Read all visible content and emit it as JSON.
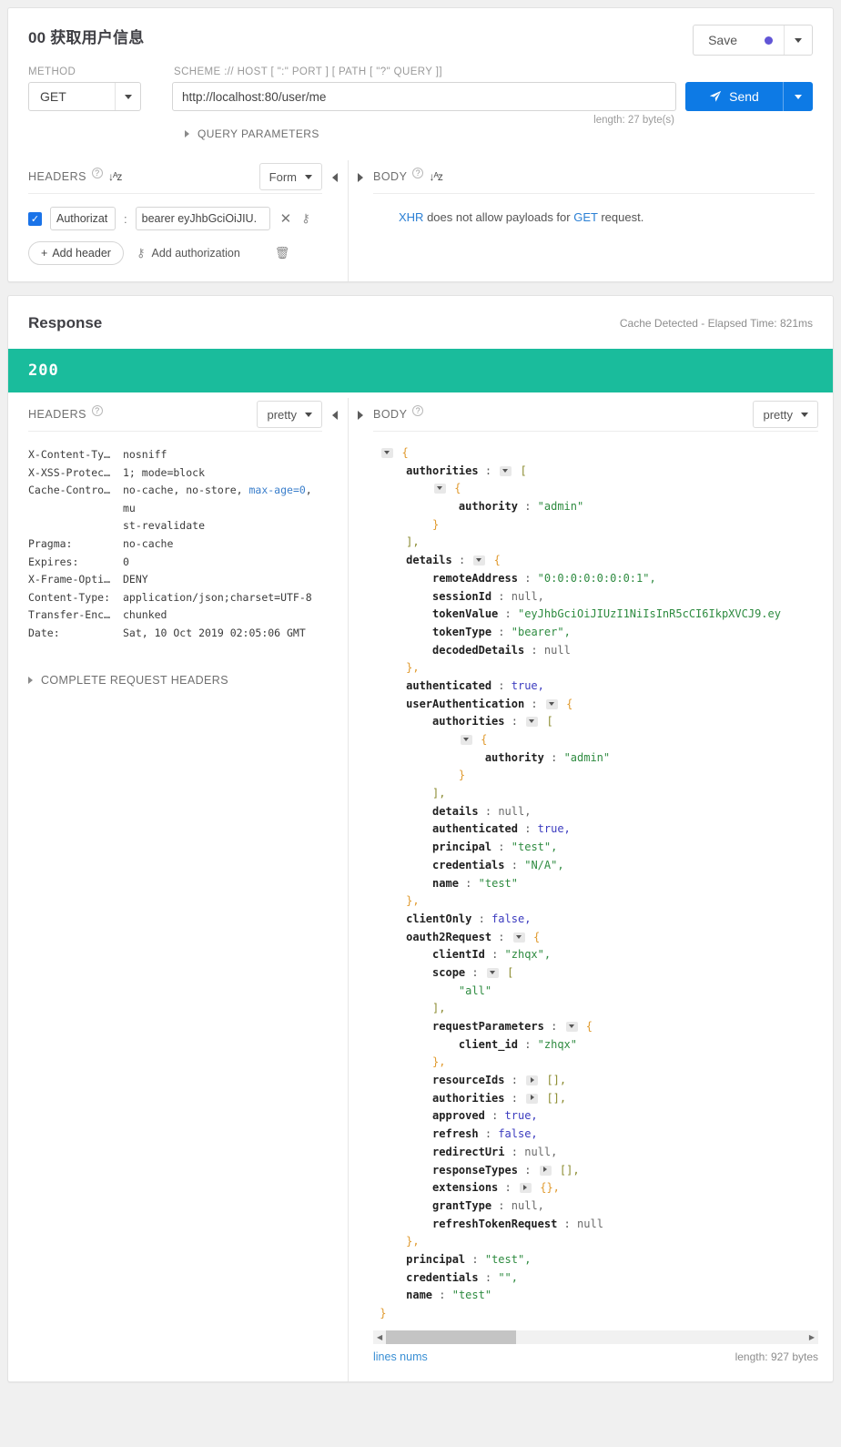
{
  "request": {
    "title": "00 获取用户信息",
    "save": {
      "label": "Save",
      "dot_color": "#6155d6"
    },
    "method_label": "METHOD",
    "method_value": "GET",
    "url_label": "SCHEME :// HOST [ \":\" PORT ] [ PATH [ \"?\" QUERY ]]",
    "url_value": "http://localhost:80/user/me",
    "send_label": "Send",
    "length_note": "length: 27 byte(s)",
    "query_parameters_label": "QUERY PARAMETERS",
    "headers_panel": {
      "title": "HEADERS",
      "format_select": "Form",
      "rows": [
        {
          "checked": true,
          "key": "Authorizat",
          "value": "bearer eyJhbGciOiJIU.",
          "separator": ":"
        }
      ],
      "add_header_label": "Add header",
      "add_authorization_label": "Add authorization"
    },
    "body_panel": {
      "title": "BODY",
      "note_prefix": "XHR",
      "note_middle": " does not allow payloads for ",
      "note_method": "GET",
      "note_suffix": " request."
    }
  },
  "response": {
    "title": "Response",
    "meta": "Cache Detected - Elapsed Time: 821ms",
    "status_code": "200",
    "status_color": "#1abc9c",
    "headers_panel": {
      "title": "HEADERS",
      "format_select": "pretty",
      "rows": [
        {
          "name": "X-Content-Ty…",
          "value": "nosniff"
        },
        {
          "name": "X-XSS-Protec…",
          "value": "1; mode=block"
        },
        {
          "name": "Cache-Contro…",
          "value": "no-cache, no-store, max-age=0, mu\nst-revalidate"
        },
        {
          "name": "Pragma:",
          "value": "no-cache"
        },
        {
          "name": "Expires:",
          "value": "0"
        },
        {
          "name": "X-Frame-Opti…",
          "value": "DENY"
        },
        {
          "name": "Content-Type:",
          "value": "application/json;charset=UTF-8"
        },
        {
          "name": "Transfer-Enc…",
          "value": "chunked"
        },
        {
          "name": "Date:",
          "value": "Sat, 10 Oct 2019 02:05:06 GMT"
        }
      ],
      "complete_request_headers_label": "COMPLETE REQUEST HEADERS"
    },
    "body_panel": {
      "title": "BODY",
      "format_select": "pretty",
      "lines_nums_label": "lines nums",
      "length_label": "length: 927 bytes",
      "json_lines": [
        {
          "indent": 0,
          "toggle": "open",
          "text": "{",
          "cls": "br"
        },
        {
          "indent": 1,
          "key": "authorities",
          "toggle": "open",
          "text": "[",
          "cls": "brk"
        },
        {
          "indent": 2,
          "toggle": "open",
          "text": "{",
          "cls": "br"
        },
        {
          "indent": 3,
          "key": "authority",
          "value": "\"admin\"",
          "vcls": "s"
        },
        {
          "indent": 2,
          "text": "}",
          "cls": "br"
        },
        {
          "indent": 1,
          "text": "],",
          "cls": "brk"
        },
        {
          "indent": 1,
          "key": "details",
          "toggle": "open",
          "text": "{",
          "cls": "br"
        },
        {
          "indent": 2,
          "key": "remoteAddress",
          "value": "\"0:0:0:0:0:0:0:1\",",
          "vcls": "s"
        },
        {
          "indent": 2,
          "key": "sessionId",
          "value": "null,",
          "vcls": "n"
        },
        {
          "indent": 2,
          "key": "tokenValue",
          "value": "\"eyJhbGciOiJIUzI1NiIsInR5cCI6IkpXVCJ9.ey",
          "vcls": "s"
        },
        {
          "indent": 2,
          "key": "tokenType",
          "value": "\"bearer\",",
          "vcls": "s"
        },
        {
          "indent": 2,
          "key": "decodedDetails",
          "value": "null",
          "vcls": "n"
        },
        {
          "indent": 1,
          "text": "},",
          "cls": "br"
        },
        {
          "indent": 1,
          "key": "authenticated",
          "value": "true,",
          "vcls": "b"
        },
        {
          "indent": 1,
          "key": "userAuthentication",
          "toggle": "open",
          "text": "{",
          "cls": "br"
        },
        {
          "indent": 2,
          "key": "authorities",
          "toggle": "open",
          "text": "[",
          "cls": "brk"
        },
        {
          "indent": 3,
          "toggle": "open",
          "text": "{",
          "cls": "br"
        },
        {
          "indent": 4,
          "key": "authority",
          "value": "\"admin\"",
          "vcls": "s"
        },
        {
          "indent": 3,
          "text": "}",
          "cls": "br"
        },
        {
          "indent": 2,
          "text": "],",
          "cls": "brk"
        },
        {
          "indent": 2,
          "key": "details",
          "value": "null,",
          "vcls": "n"
        },
        {
          "indent": 2,
          "key": "authenticated",
          "value": "true,",
          "vcls": "b"
        },
        {
          "indent": 2,
          "key": "principal",
          "value": "\"test\",",
          "vcls": "s"
        },
        {
          "indent": 2,
          "key": "credentials",
          "value": "\"N/A\",",
          "vcls": "s"
        },
        {
          "indent": 2,
          "key": "name",
          "value": "\"test\"",
          "vcls": "s"
        },
        {
          "indent": 1,
          "text": "},",
          "cls": "br"
        },
        {
          "indent": 1,
          "key": "clientOnly",
          "value": "false,",
          "vcls": "b"
        },
        {
          "indent": 1,
          "key": "oauth2Request",
          "toggle": "open",
          "text": "{",
          "cls": "br"
        },
        {
          "indent": 2,
          "key": "clientId",
          "value": "\"zhqx\",",
          "vcls": "s"
        },
        {
          "indent": 2,
          "key": "scope",
          "toggle": "open",
          "text": "[",
          "cls": "brk"
        },
        {
          "indent": 3,
          "value": "\"all\"",
          "vcls": "s"
        },
        {
          "indent": 2,
          "text": "],",
          "cls": "brk"
        },
        {
          "indent": 2,
          "key": "requestParameters",
          "toggle": "open",
          "text": "{",
          "cls": "br"
        },
        {
          "indent": 3,
          "key": "client_id",
          "value": "\"zhqx\"",
          "vcls": "s"
        },
        {
          "indent": 2,
          "text": "},",
          "cls": "br"
        },
        {
          "indent": 2,
          "key": "resourceIds",
          "toggle": "closed",
          "text": "[],",
          "cls": "brk"
        },
        {
          "indent": 2,
          "key": "authorities",
          "toggle": "closed",
          "text": "[],",
          "cls": "brk"
        },
        {
          "indent": 2,
          "key": "approved",
          "value": "true,",
          "vcls": "b"
        },
        {
          "indent": 2,
          "key": "refresh",
          "value": "false,",
          "vcls": "b"
        },
        {
          "indent": 2,
          "key": "redirectUri",
          "value": "null,",
          "vcls": "n"
        },
        {
          "indent": 2,
          "key": "responseTypes",
          "toggle": "closed",
          "text": "[],",
          "cls": "brk"
        },
        {
          "indent": 2,
          "key": "extensions",
          "toggle": "closed",
          "text": "{},",
          "cls": "br"
        },
        {
          "indent": 2,
          "key": "grantType",
          "value": "null,",
          "vcls": "n"
        },
        {
          "indent": 2,
          "key": "refreshTokenRequest",
          "value": "null",
          "vcls": "n"
        },
        {
          "indent": 1,
          "text": "},",
          "cls": "br"
        },
        {
          "indent": 1,
          "key": "principal",
          "value": "\"test\",",
          "vcls": "s"
        },
        {
          "indent": 1,
          "key": "credentials",
          "value": "\"\",",
          "vcls": "s"
        },
        {
          "indent": 1,
          "key": "name",
          "value": "\"test\"",
          "vcls": "s"
        },
        {
          "indent": 0,
          "text": "}",
          "cls": "br"
        }
      ]
    }
  }
}
